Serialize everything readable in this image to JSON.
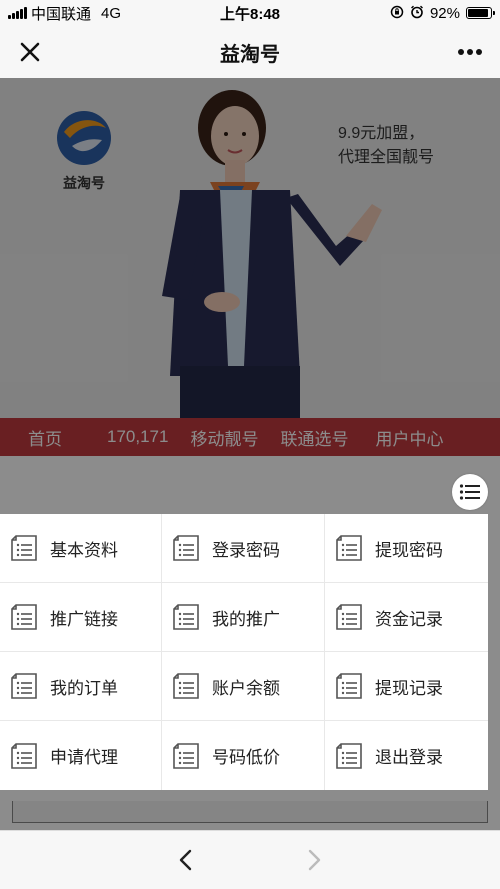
{
  "status_bar": {
    "carrier": "中国联通",
    "network": "4G",
    "time": "上午8:48",
    "battery": "92%",
    "battery_level": 0.92
  },
  "nav": {
    "title": "益淘号"
  },
  "banner": {
    "logo_text": "益淘号",
    "line1": "9.9元加盟，",
    "line2": "代理全国靓号"
  },
  "top_nav": {
    "items": [
      "首页",
      "170,171",
      "移动靓号",
      "联通选号",
      "用户中心"
    ]
  },
  "menu": {
    "items": [
      {
        "label": "基本资料"
      },
      {
        "label": "登录密码"
      },
      {
        "label": "提现密码"
      },
      {
        "label": "推广链接"
      },
      {
        "label": "我的推广"
      },
      {
        "label": "资金记录"
      },
      {
        "label": "我的订单"
      },
      {
        "label": "账户余额"
      },
      {
        "label": "提现记录"
      },
      {
        "label": "申请代理"
      },
      {
        "label": "号码低价"
      },
      {
        "label": "退出登录"
      }
    ]
  },
  "colors": {
    "nav_red": "#c0393f",
    "logo_blue": "#2e5fa8",
    "logo_orange": "#f29b1d"
  }
}
